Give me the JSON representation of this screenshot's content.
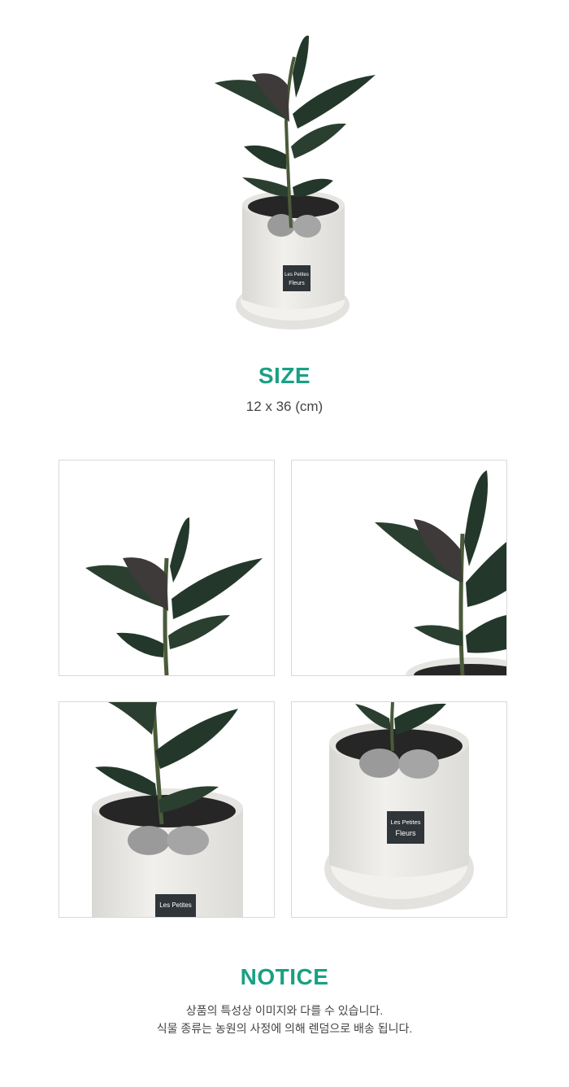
{
  "product": {
    "pot_label_line1": "Les Petites",
    "pot_label_line2": "Fleurs"
  },
  "size": {
    "title": "SIZE",
    "value": "12 x 36 (cm)"
  },
  "notice": {
    "title": "NOTICE",
    "lines": [
      "상품의 특성상 이미지와 다를 수 있습니다.",
      "식물 종류는 농원의 사정에 의해 렌덤으로 배송 됩니다."
    ]
  },
  "colors": {
    "accent": "#1aa083",
    "leaf": "#23382a",
    "pot": "#ecebe8",
    "soil": "#2a2a2a",
    "label_bg": "#2f3538"
  }
}
